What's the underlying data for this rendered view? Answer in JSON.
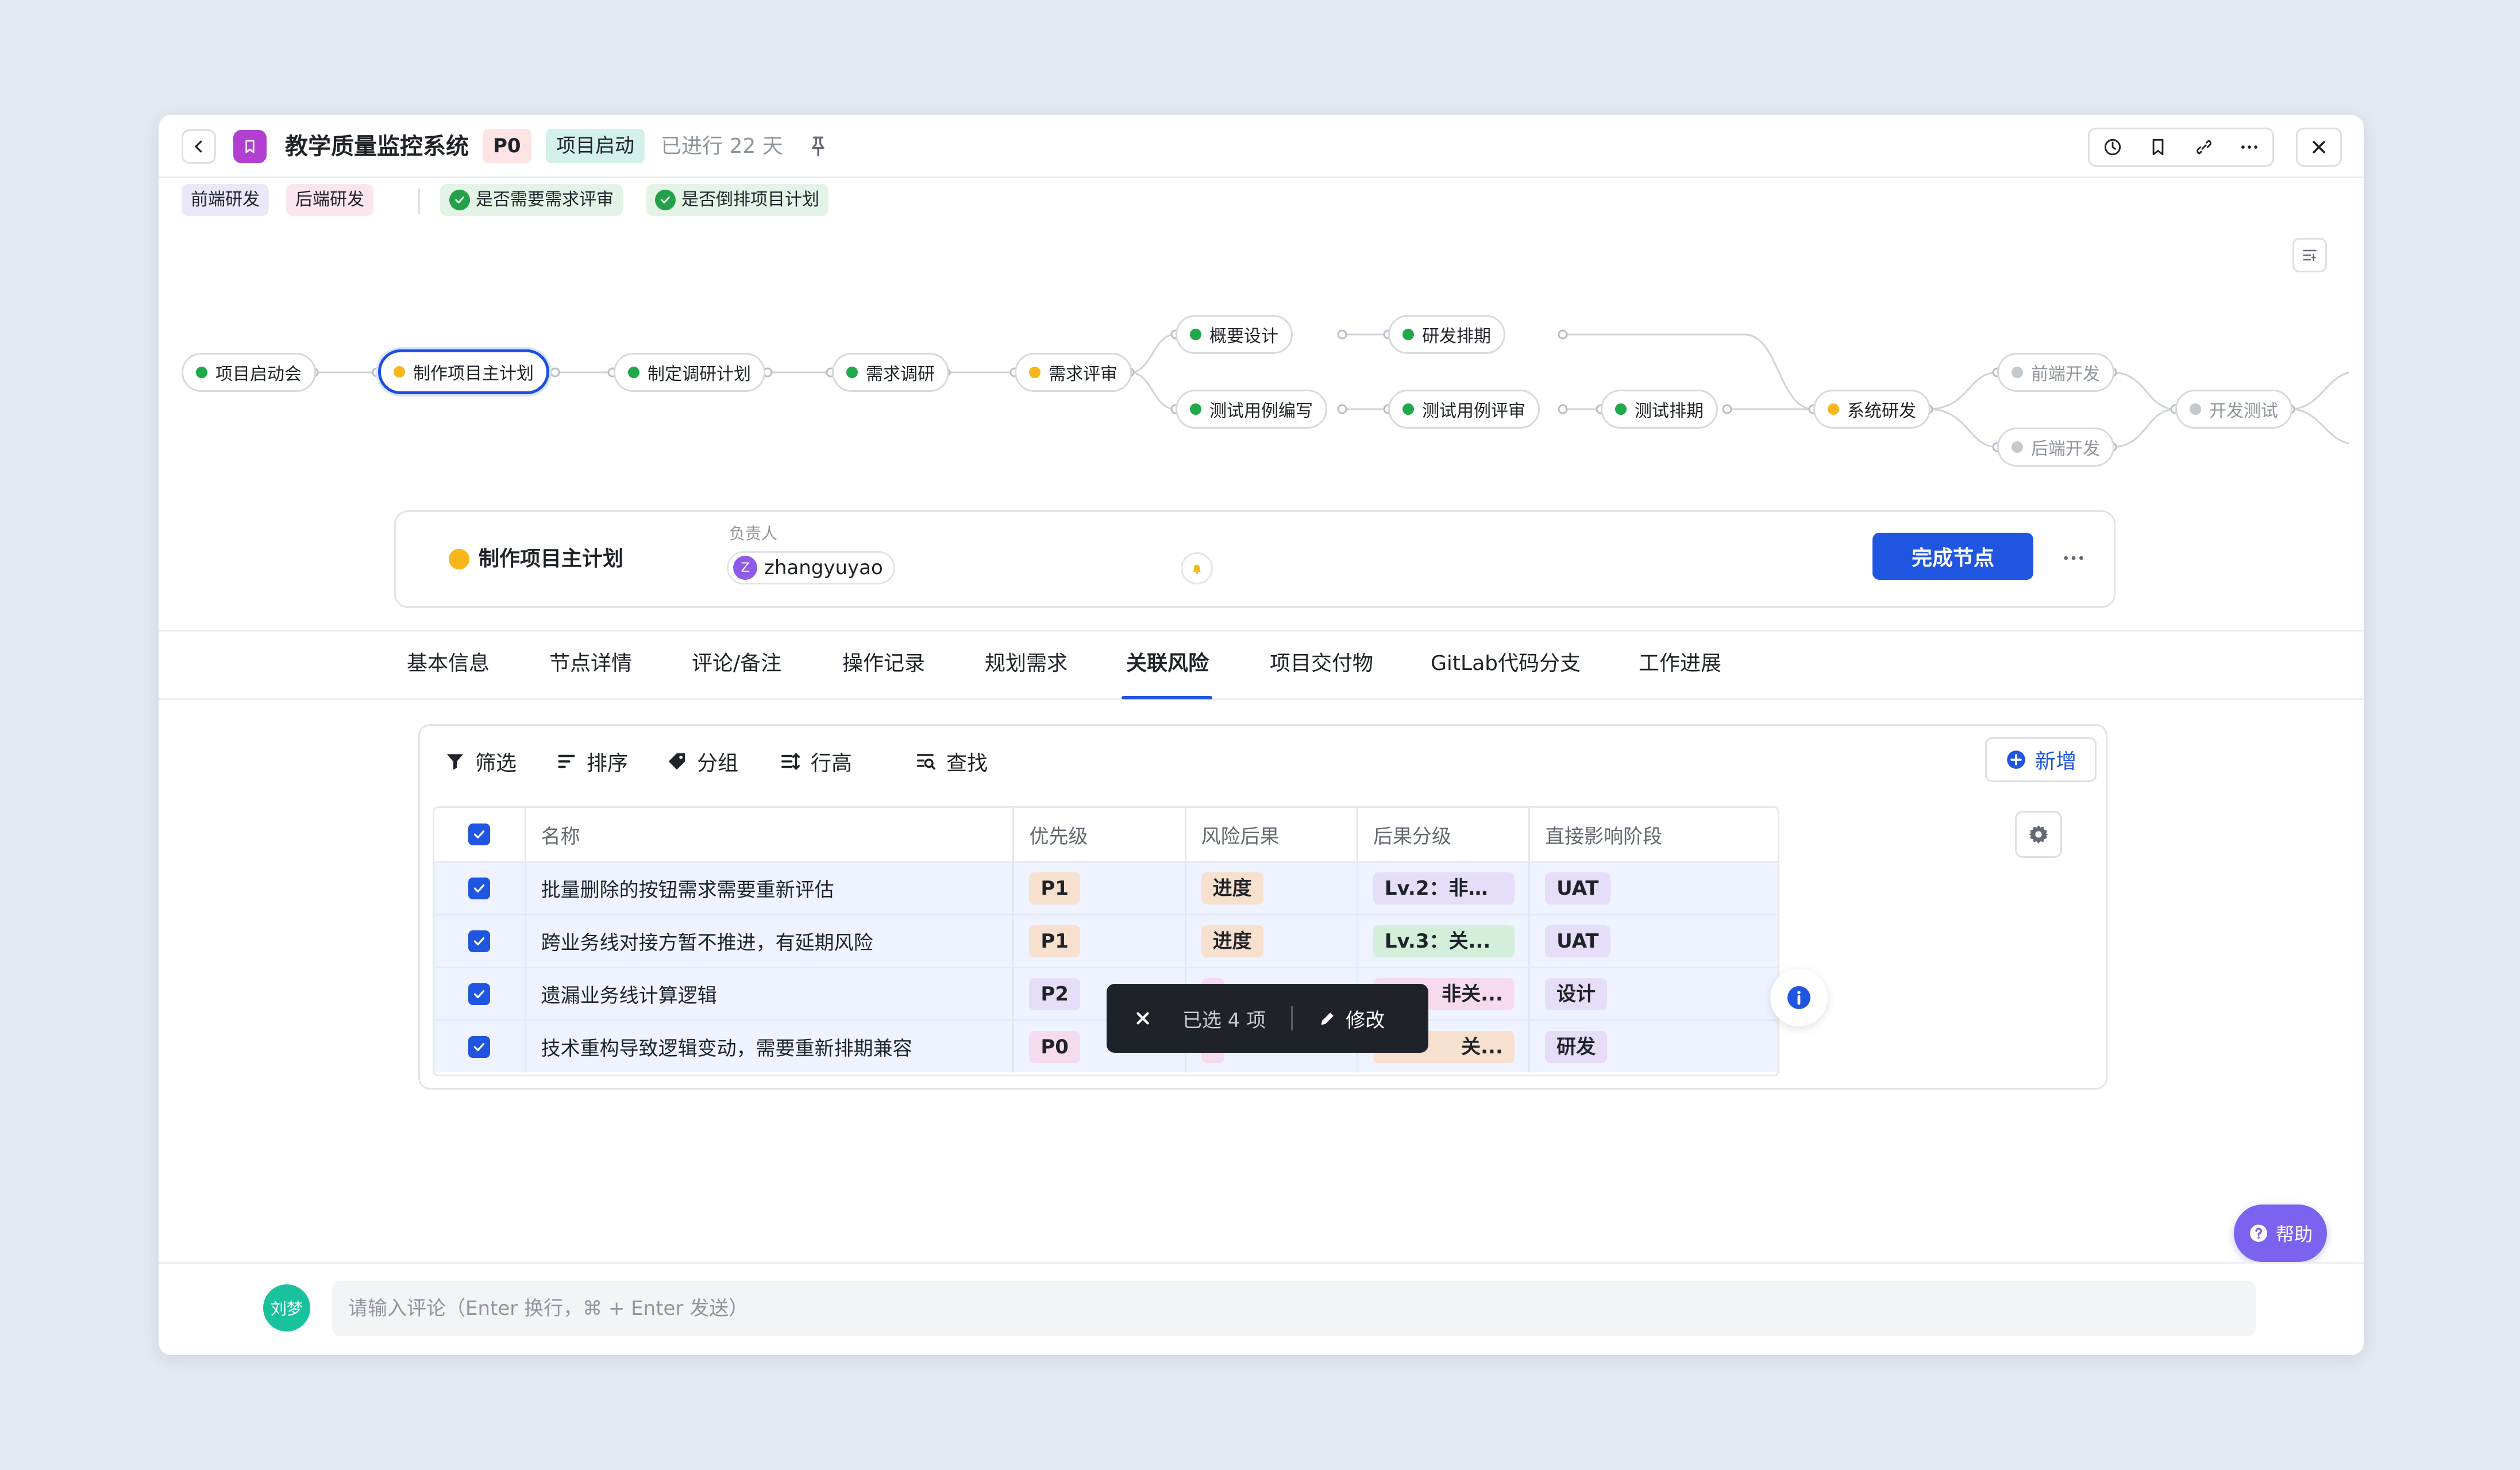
{
  "header": {
    "title": "教学质量监控系统",
    "priority": "P0",
    "stage": "项目启动",
    "elapsed": "已进行 22 天"
  },
  "tags": {
    "frontend": "前端研发",
    "backend": "后端研发",
    "check1": "是否需要需求评审",
    "check2": "是否倒排项目计划"
  },
  "flow": {
    "nodes": [
      {
        "label": "项目启动会",
        "status": "done"
      },
      {
        "label": "制作项目主计划",
        "status": "in-progress"
      },
      {
        "label": "制定调研计划",
        "status": "done"
      },
      {
        "label": "需求调研",
        "status": "done"
      },
      {
        "label": "需求评审",
        "status": "in-progress"
      },
      {
        "label": "概要设计",
        "status": "done"
      },
      {
        "label": "研发排期",
        "status": "done"
      },
      {
        "label": "测试用例编写",
        "status": "done"
      },
      {
        "label": "测试用例评审",
        "status": "done"
      },
      {
        "label": "测试排期",
        "status": "done"
      },
      {
        "label": "系统研发",
        "status": "in-progress"
      },
      {
        "label": "前端开发",
        "status": "pending"
      },
      {
        "label": "后端开发",
        "status": "pending"
      },
      {
        "label": "开发测试",
        "status": "pending"
      }
    ]
  },
  "card": {
    "node_name": "制作项目主计划",
    "owner_label": "负责人",
    "owner_initial": "Z",
    "owner_name": "zhangyuyao",
    "complete_label": "完成节点"
  },
  "tabs": [
    {
      "label": "基本信息"
    },
    {
      "label": "节点详情"
    },
    {
      "label": "评论/备注"
    },
    {
      "label": "操作记录"
    },
    {
      "label": "规划需求"
    },
    {
      "label": "关联风险",
      "active": true
    },
    {
      "label": "项目交付物"
    },
    {
      "label": "GitLab代码分支"
    },
    {
      "label": "工作进展"
    }
  ],
  "toolbar": {
    "filter": "筛选",
    "sort": "排序",
    "group": "分组",
    "row_height": "行高",
    "search": "查找",
    "add": "新增"
  },
  "table": {
    "columns": [
      "名称",
      "优先级",
      "风险后果",
      "后果分级",
      "直接影响阶段"
    ],
    "rows": [
      {
        "name": "批量删除的按钮需求需要重新评估",
        "priority": "P1",
        "consequence": "进度",
        "level": "Lv.2：非关...",
        "stage": "UAT"
      },
      {
        "name": "跨业务线对接方暂不推进，有延期风险",
        "priority": "P1",
        "consequence": "进度",
        "level": "Lv.3：关...",
        "stage": "UAT"
      },
      {
        "name": "遗漏业务线计算逻辑",
        "priority": "P2",
        "consequence": "",
        "level": "非关...",
        "stage": "设计"
      },
      {
        "name": "技术重构导致逻辑变动，需要重新排期兼容",
        "priority": "P0",
        "consequence": "",
        "level": "关...",
        "stage": "研发"
      }
    ]
  },
  "selection": {
    "count_text": "已选 4 项",
    "edit_label": "修改"
  },
  "help": {
    "label": "帮助"
  },
  "comment": {
    "avatar_text": "刘梦",
    "placeholder": "请输入评论（Enter 换行，⌘ + Enter 发送）"
  },
  "colors": {
    "primary": "#1f55e0",
    "done": "#20a84a",
    "in_progress": "#f7b71a",
    "pending": "#c4c8cf"
  }
}
